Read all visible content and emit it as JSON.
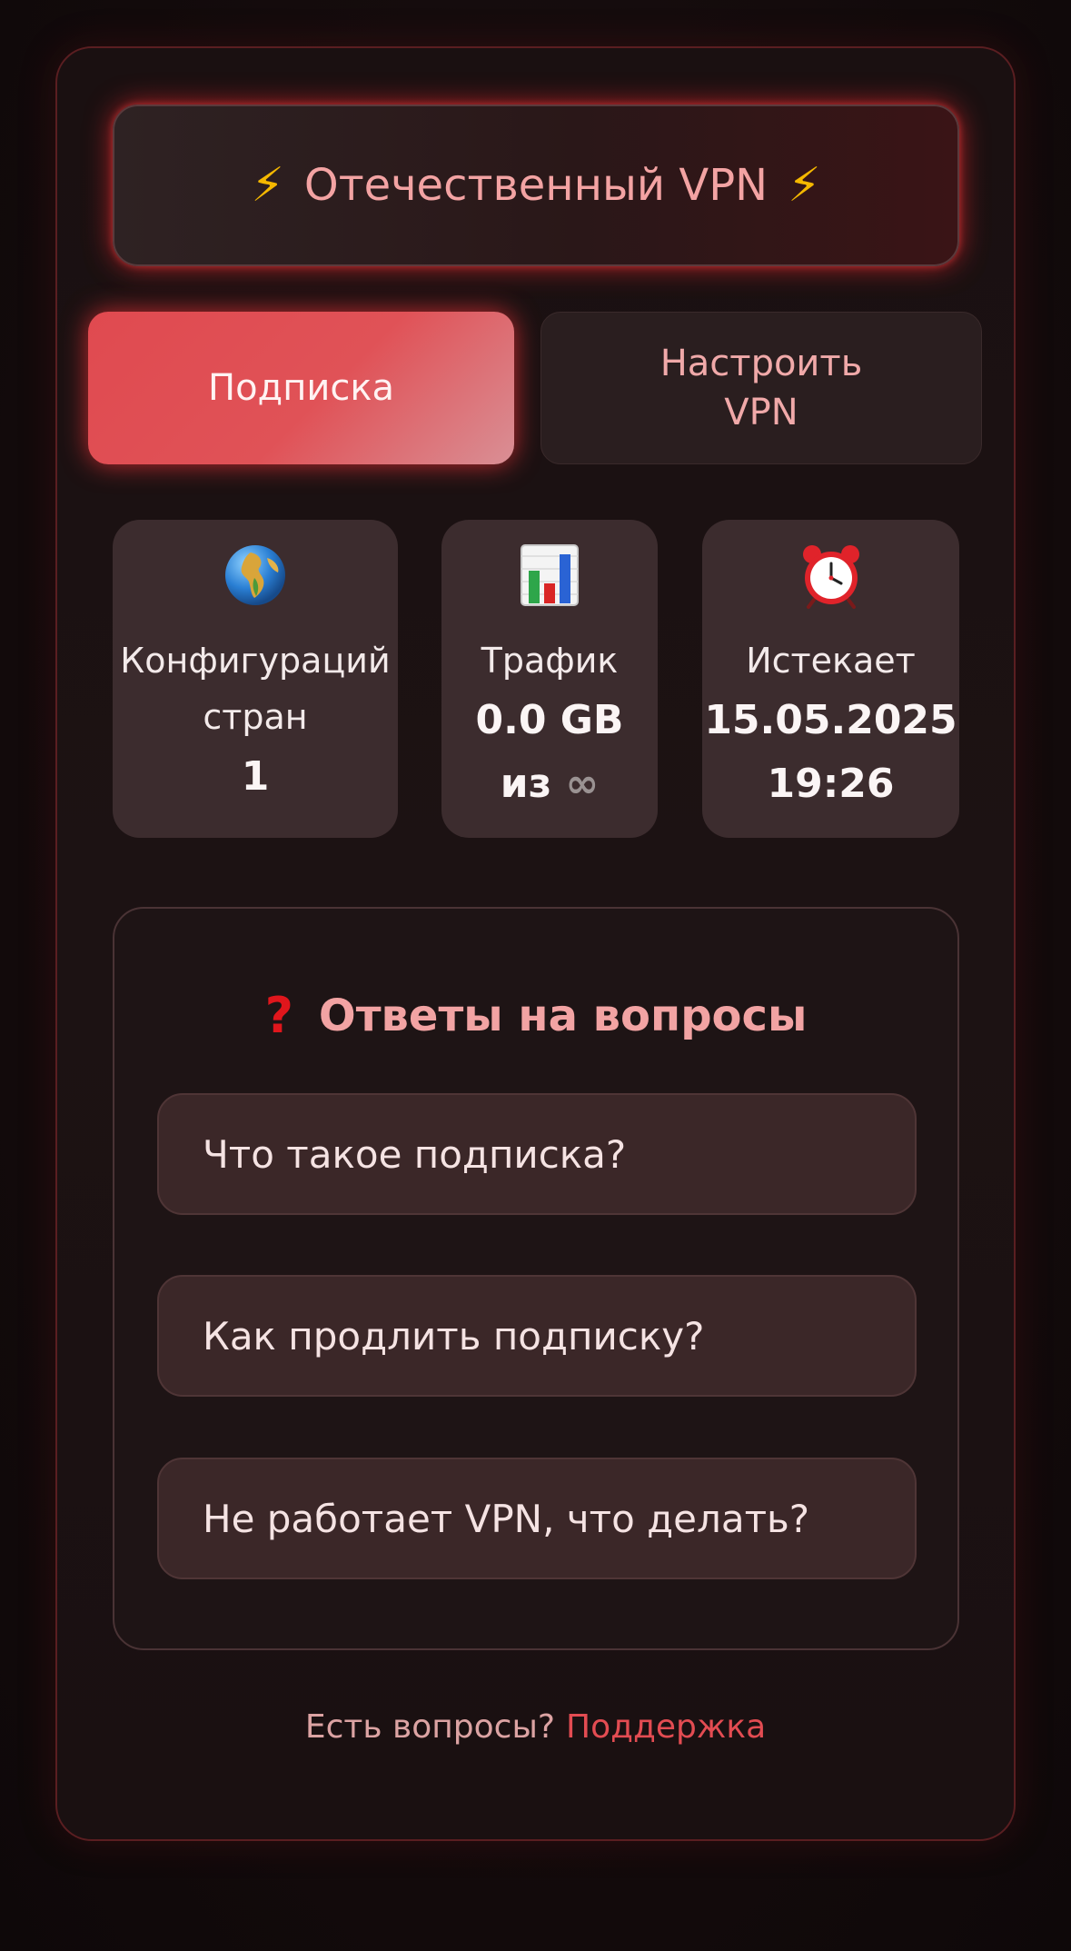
{
  "header": {
    "title": "Отечественный VPN",
    "left_icon": "lightning-icon",
    "right_icon": "lightning-icon"
  },
  "tabs": [
    {
      "label": "Подписка",
      "active": true
    },
    {
      "label": "Настроить VPN",
      "line1": "Настроить",
      "line2": "VPN",
      "active": false
    }
  ],
  "stats": {
    "configs": {
      "icon": "globe-icon",
      "label_line1": "Конфигураций",
      "label_line2": "стран",
      "value": "1"
    },
    "traffic": {
      "icon": "bar-chart-icon",
      "label": "Трафик",
      "value": "0.0 GB",
      "limit_prefix": "из",
      "limit": "∞"
    },
    "expires": {
      "icon": "alarm-clock-icon",
      "label": "Истекает",
      "date": "15.05.2025",
      "time": "19:26"
    }
  },
  "faq": {
    "icon": "question-mark-icon",
    "title": "Ответы на вопросы",
    "items": [
      "Что такое подписка?",
      "Как продлить подписку?",
      "Не работает VPN, что делать?"
    ]
  },
  "footer": {
    "text": "Есть вопросы?",
    "link": "Поддержка"
  },
  "colors": {
    "accent": "#e04a50",
    "background": "#1a1011",
    "tile": "#3c2c2e",
    "link": "#e34c52"
  }
}
